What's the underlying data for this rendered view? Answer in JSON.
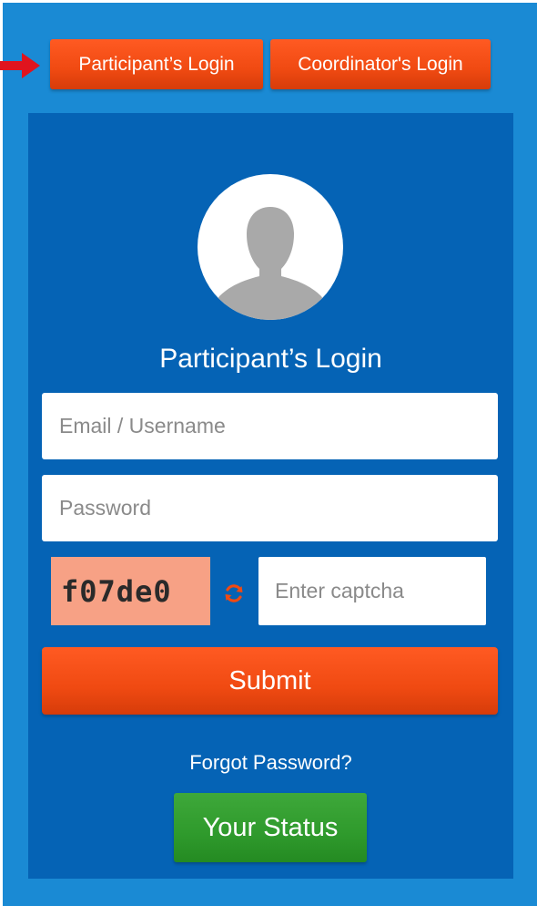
{
  "tabs": {
    "participant_label": "Participant’s Login",
    "coordinator_label": "Coordinator's Login"
  },
  "form": {
    "title": "Participant’s Login",
    "email_placeholder": "Email / Username",
    "password_placeholder": "Password",
    "captcha_text": "f07de0",
    "captcha_placeholder": "Enter captcha",
    "submit_label": "Submit",
    "forgot_label": "Forgot Password?",
    "status_label": "Your Status"
  },
  "colors": {
    "page_background": "#1a8ad4",
    "panel_background": "#0563b5",
    "accent_orange": "#f04a12",
    "status_green": "#2f9a2c",
    "captcha_background": "#f7a185",
    "pointer_arrow": "#e0141e"
  },
  "icons": {
    "arrow": "arrow-right-icon",
    "avatar": "user-silhouette-icon",
    "refresh": "refresh-icon"
  }
}
